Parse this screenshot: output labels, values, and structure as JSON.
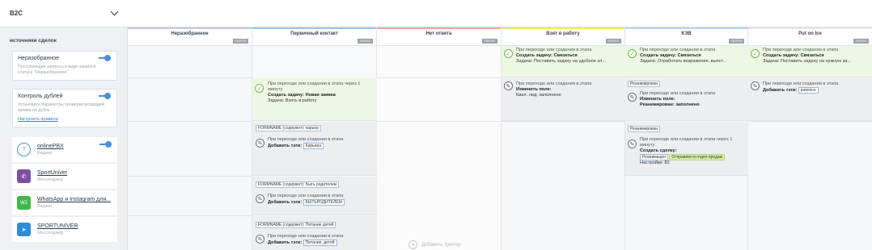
{
  "pipeline": {
    "name": "B2C"
  },
  "sources": {
    "title": "источники сделок",
    "unsorted": {
      "title": "Неразобранное",
      "desc": "Поступающие запросы в виде заявок в статусе \"Неразобранное\""
    },
    "dedup": {
      "title": "Контроль дублей",
      "desc": "Установите параметры проверки входящей заявки на дубль",
      "link": "Настроить правила"
    },
    "items": [
      {
        "name": "onlinePBX",
        "sub": "Виджет",
        "icon": "question-icon",
        "color": "#ffffff"
      },
      {
        "name": "SportUniver",
        "sub": "Мессенджер",
        "icon": "viber-icon",
        "color": "#7b4fa0"
      },
      {
        "name": "WhatsApp и Instagram для...",
        "sub": "Виджет",
        "icon": "wazzup-icon",
        "color": "#3fb84a"
      },
      {
        "name": "SPORTUNIVER",
        "sub": "Мессенджер",
        "icon": "telegram-icon",
        "color": "#2b8fd8"
      }
    ]
  },
  "stages": [
    {
      "name": "Неразобранное",
      "count": "000000",
      "color": "#c7cbd1"
    },
    {
      "name": "Первичный контакт",
      "count": "000000",
      "color": "#99c3ea"
    },
    {
      "name": "Нет ответа",
      "count": "000000",
      "color": "#f0a3a3"
    },
    {
      "name": "Взят в работу",
      "count": "000000",
      "color": "#f2e86a"
    },
    {
      "name": "КЭВ",
      "count": "000000",
      "color": "#b7d4f2"
    },
    {
      "name": "Put on Ice",
      "count": "000000",
      "color": "#e3e5e8"
    }
  ],
  "triggers": {
    "r1_vzyat": {
      "cond": "При переходе или создании в этапа",
      "action": "Создать задачу: Связаться",
      "detail": "Задача: Поставить задачу на удобное зл..."
    },
    "r1_kev": {
      "cond": "При переходе или создании в этапа",
      "action": "Создать задачу: Связаться",
      "detail": "Задача: Отработать возражения, выяст..."
    },
    "r1_ice": {
      "cond": "При переходе или создании в этапа",
      "action": "Создать задачу: Связаться",
      "detail": "Задача: Поставить задачу на нужную за..."
    },
    "r2_prim": {
      "cond": "При переходе или создании в этапа через 1 минуту",
      "action": "Создать задачу: Новая заявка",
      "detail": "Задача: Взять в работу"
    },
    "r2_vzyat": {
      "cond": "При переходе или создании в этапа",
      "action": "Изменить поле:",
      "detail": "Квал. лид: заполнено"
    },
    "r2_kev": {
      "tag": "Реанимирован",
      "cond": "При переходе или создании в этапа",
      "action": "Изменить поле:",
      "detail": "Реанимирован: заполнено"
    },
    "r2_ice": {
      "cond": "При переходе или создании в этапа",
      "action": "Добавить тэги:",
      "chip": "putonice"
    },
    "r3_prim": {
      "tag": "FORMNAME (содержит): карьер",
      "cond": "При переходе или создании в этапа",
      "action": "Добавить тэги:",
      "chip": "Карьера"
    },
    "r3_kev": {
      "tag": "Реанимирован",
      "cond": "При переходе или создании в этапа через 1 минуту",
      "action": "Создать сделку:",
      "chip1": "Реанимация",
      "chip2": "Отправлен в отдел продаж",
      "detail": "Настройки: 82"
    },
    "r4_prim": {
      "tag": "FORMNAME (содержит): Быть родителем",
      "cond": "При переходе или создании в этапа",
      "action": "Добавить тэги:",
      "chip": "БЫТЬРОДИТЕЛЕМ"
    },
    "r5_prim": {
      "tag": "FORMNAME (содержит): Питание детей",
      "cond": "При переходе или создании в этапа",
      "action": "Добавить тэги:",
      "chip": "Питание_детей"
    }
  },
  "add_trigger": "Добавить триггер"
}
